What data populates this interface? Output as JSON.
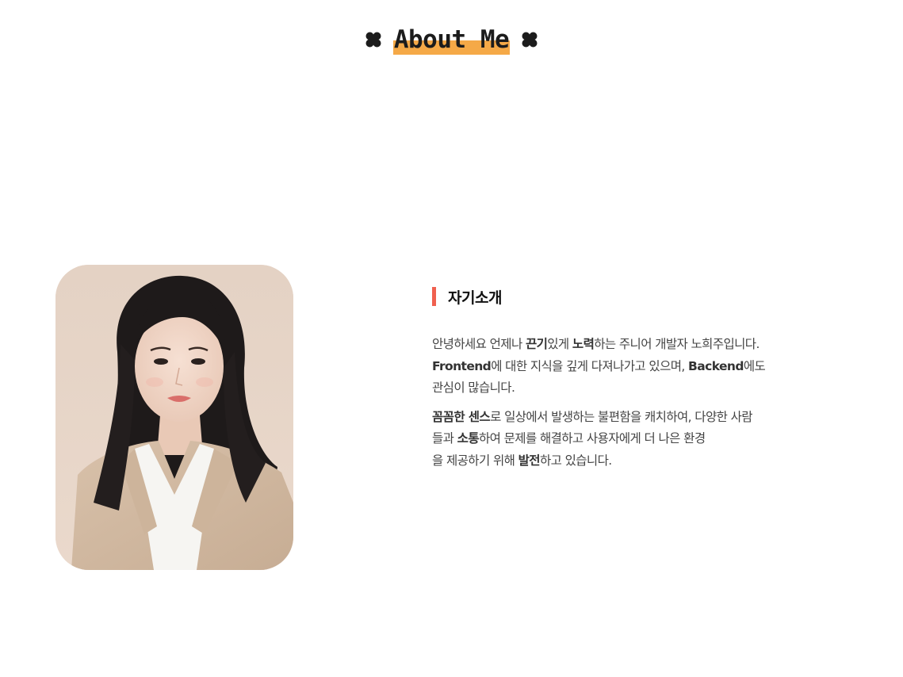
{
  "section": {
    "title": "About Me",
    "decoration_icon": "clover-icon",
    "highlight_color": "#f5a947"
  },
  "profile": {
    "photo_alt": "profile-photo"
  },
  "intro": {
    "heading": "자기소개",
    "accent_color": "#f0604f",
    "paragraph1": {
      "line1": [
        {
          "text": "안녕하세요 언제나 ",
          "bold": false
        },
        {
          "text": "끈기",
          "bold": true
        },
        {
          "text": "있게 ",
          "bold": false
        },
        {
          "text": "노력",
          "bold": true
        },
        {
          "text": "하는 주니어 개발자 노희주입니다.",
          "bold": false
        }
      ],
      "line2": [
        {
          "text": "Frontend",
          "bold": true
        },
        {
          "text": "에 대한 지식을 깊게 다져나가고 있으며, ",
          "bold": false
        },
        {
          "text": "Backend",
          "bold": true
        },
        {
          "text": "에도",
          "bold": false
        }
      ],
      "line3": [
        {
          "text": "관심이 많습니다.",
          "bold": false
        }
      ]
    },
    "paragraph2": {
      "line1": [
        {
          "text": "꼼꼼한 센스",
          "bold": true
        },
        {
          "text": "로 일상에서 발생하는 불편함을 캐치하여, 다양한 사람",
          "bold": false
        }
      ],
      "line2": [
        {
          "text": "들과 ",
          "bold": false
        },
        {
          "text": "소통",
          "bold": true
        },
        {
          "text": "하여 문제를 해결하고 사용자에게 더 나은 환경",
          "bold": false
        }
      ],
      "line3": [
        {
          "text": "을 제공하기 위해 ",
          "bold": false
        },
        {
          "text": "발전",
          "bold": true
        },
        {
          "text": "하고 있습니다.",
          "bold": false
        }
      ]
    }
  }
}
